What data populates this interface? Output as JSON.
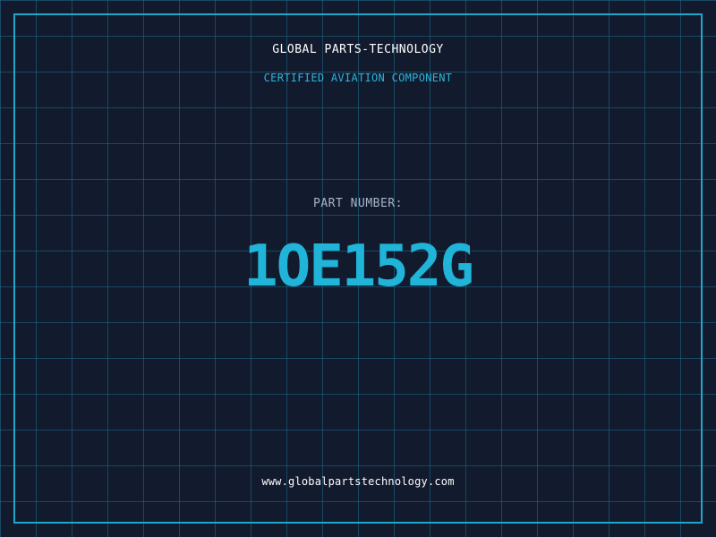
{
  "label": {
    "company_name": "GLOBAL PARTS-TECHNOLOGY",
    "subtitle": "CERTIFIED AVIATION COMPONENT",
    "part_number_label": "PART NUMBER:",
    "part_number": "1OE152G",
    "website": "www.globalpartstechnology.com"
  },
  "colors": {
    "background": "#121a2e",
    "grid": "#1f6e8c",
    "frame": "#1fa6c9",
    "accent": "#1fb4d8",
    "title_text": "#ffffff",
    "label_text": "#a7b4c8"
  }
}
